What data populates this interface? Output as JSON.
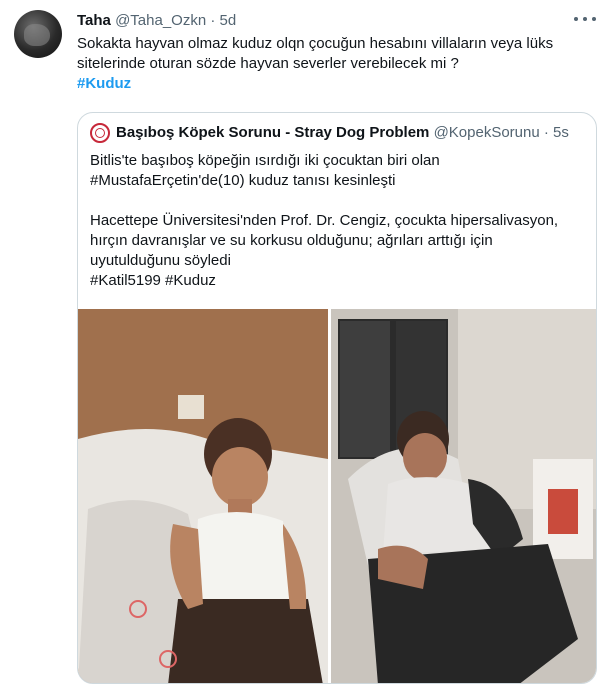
{
  "tweet": {
    "name": "Taha",
    "handle": "@Taha_Ozkn",
    "separator": "·",
    "time": "5d",
    "text_line1": "Sokakta hayvan olmaz kuduz olqn çocuğun hesabını villaların veya lüks",
    "text_line2": "sitelerinde oturan sözde hayvan severler verebilecek mi ?",
    "hashtag": "#Kuduz"
  },
  "quote": {
    "name": "Başıboş Köpek Sorunu - Stray Dog Problem",
    "handle": "@KopekSorunu",
    "separator": "·",
    "time": "5s",
    "lines": [
      "Bitlis'te başıboş köpeğin ısırdığı iki çocuktan biri olan",
      "#MustafaErçetin'de(10) kuduz tanısı kesinleşti",
      "",
      "Hacettepe Üniversitesi'nden Prof. Dr. Cengiz, çocukta hipersalivasyon,",
      "hırçın davranışlar ve su korkusu olduğunu; ağrıları arttığı için",
      "uyutulduğunu söyledi",
      "#Katil5199 #Kuduz"
    ]
  },
  "icons": {
    "more": "more-horizontal-icon",
    "quote_avatar": "stray-dog-logo-icon"
  },
  "colors": {
    "link": "#1d9bf0",
    "muted": "#536471",
    "border": "#cfd9de",
    "text": "#0f1419"
  }
}
